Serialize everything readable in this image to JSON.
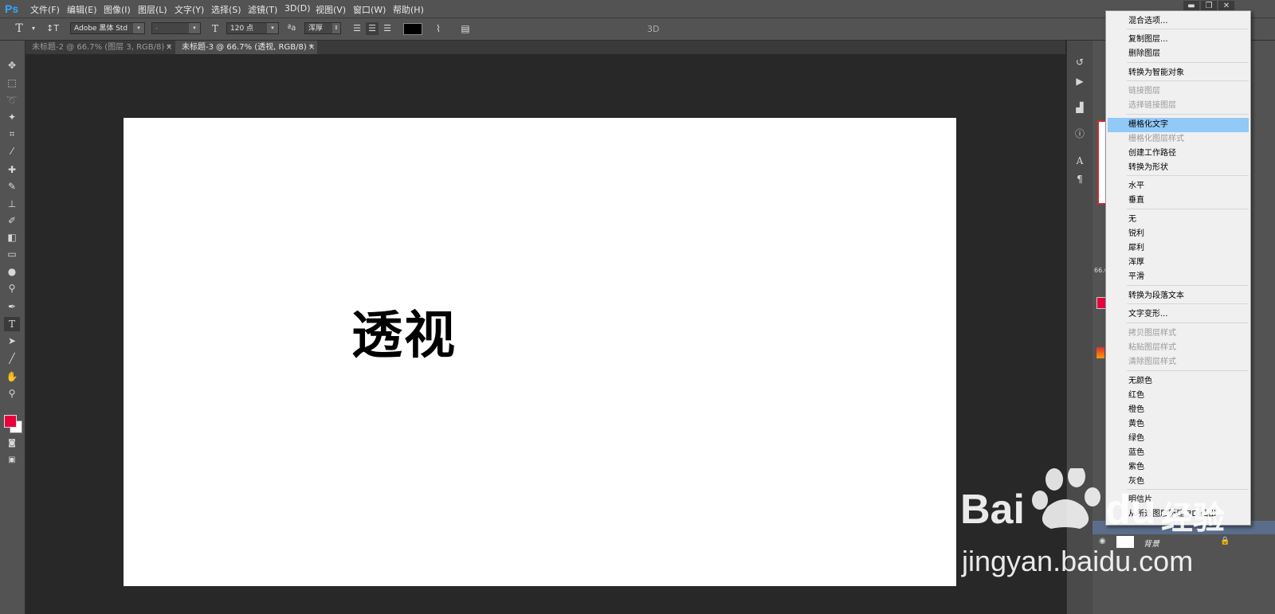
{
  "app": {
    "logo": "Ps"
  },
  "menubar": {
    "items": [
      "文件(F)",
      "编辑(E)",
      "图像(I)",
      "图层(L)",
      "文字(Y)",
      "选择(S)",
      "滤镜(T)",
      "3D(D)",
      "视图(V)",
      "窗口(W)",
      "帮助(H)"
    ],
    "window_buttons": {
      "minimize": "▬",
      "restore": "❐",
      "close": "✕"
    }
  },
  "options": {
    "tool_glyph": "T",
    "font_family": "Adobe 黑体 Std",
    "font_style": "-",
    "font_size": "120 点",
    "aa_label": "ªa",
    "antialias": "浑厚",
    "mode_label": "3D",
    "text_color": "#000000"
  },
  "tabs": [
    {
      "label": "未标题-2 @ 66.7% (图层 3, RGB/8) *",
      "close": "×"
    },
    {
      "label": "未标题-3 @ 66.7% (透视, RGB/8) *",
      "close": "×"
    }
  ],
  "canvas": {
    "text": "透视"
  },
  "colors": {
    "foreground": "#e8003d",
    "background": "#ffffff",
    "highlight": "#91c9f7"
  },
  "panel_peek": {
    "zoom": "66.6"
  },
  "context_menu": {
    "items": [
      {
        "label": "混合选项...",
        "disabled": false
      },
      {
        "label": "复制图层...",
        "disabled": false
      },
      {
        "label": "删除图层",
        "disabled": false
      },
      {
        "label": "转换为智能对象",
        "disabled": false
      },
      {
        "label": "链接图层",
        "disabled": true
      },
      {
        "label": "选择链接图层",
        "disabled": true
      },
      {
        "label": "栅格化文字",
        "disabled": false,
        "highlighted": true
      },
      {
        "label": "栅格化图层样式",
        "disabled": true
      },
      {
        "label": "创建工作路径",
        "disabled": false
      },
      {
        "label": "转换为形状",
        "disabled": false
      },
      {
        "label": "水平",
        "disabled": false
      },
      {
        "label": "垂直",
        "disabled": false
      },
      {
        "label": "无",
        "disabled": false
      },
      {
        "label": "锐利",
        "disabled": false
      },
      {
        "label": "犀利",
        "disabled": false
      },
      {
        "label": "浑厚",
        "disabled": false
      },
      {
        "label": "平滑",
        "disabled": false
      },
      {
        "label": "转换为段落文本",
        "disabled": false
      },
      {
        "label": "文字变形...",
        "disabled": false
      },
      {
        "label": "拷贝图层样式",
        "disabled": true
      },
      {
        "label": "粘贴图层样式",
        "disabled": true
      },
      {
        "label": "清除图层样式",
        "disabled": true
      },
      {
        "label": "无颜色",
        "disabled": false
      },
      {
        "label": "红色",
        "disabled": false
      },
      {
        "label": "橙色",
        "disabled": false
      },
      {
        "label": "黄色",
        "disabled": false
      },
      {
        "label": "绿色",
        "disabled": false
      },
      {
        "label": "蓝色",
        "disabled": false
      },
      {
        "label": "紫色",
        "disabled": false
      },
      {
        "label": "灰色",
        "disabled": false
      },
      {
        "label": "明信片",
        "disabled": false
      },
      {
        "label": "从所选图层新建 3D 凸出",
        "disabled": false
      }
    ]
  },
  "layers": {
    "background_name": "背景"
  },
  "watermark": {
    "brand": "Bai",
    "brand_tail": "du",
    "cn": "经验",
    "url": "jingyan.baidu.com"
  }
}
